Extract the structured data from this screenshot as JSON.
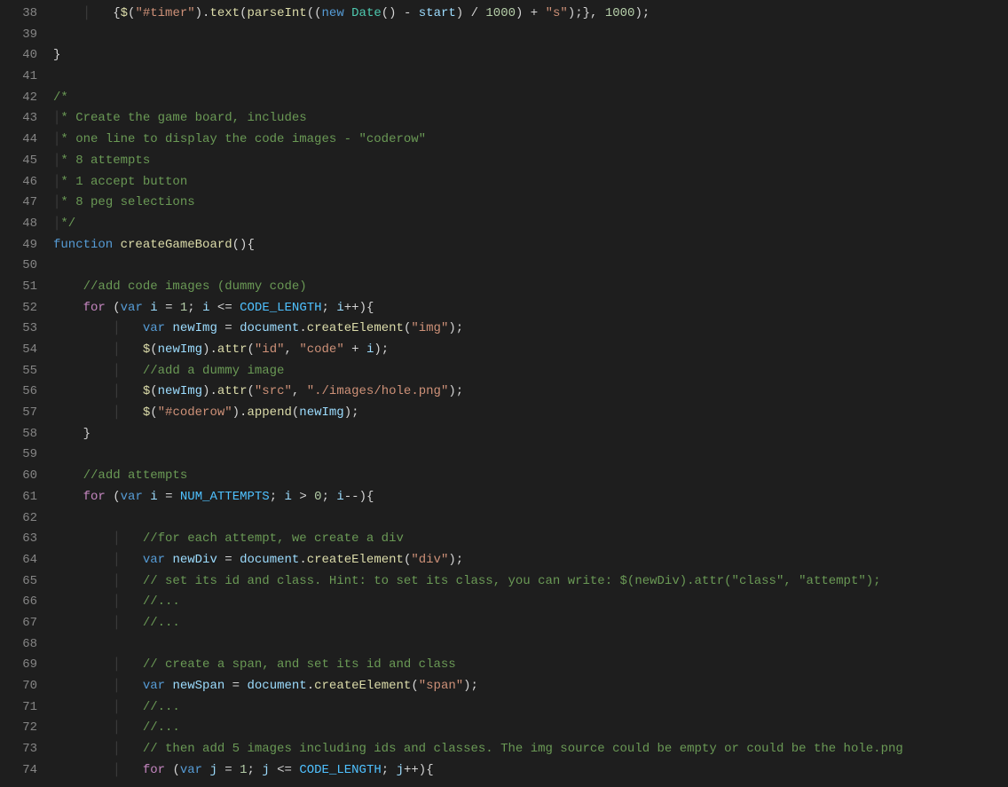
{
  "lines": [
    {
      "num": 38,
      "indent": 1,
      "tokens": [
        {
          "t": "guide",
          "v": "│   "
        },
        {
          "t": "op",
          "v": "{"
        },
        {
          "t": "fn",
          "v": "$"
        },
        {
          "t": "op",
          "v": "("
        },
        {
          "t": "str",
          "v": "\"#timer\""
        },
        {
          "t": "op",
          "v": ")."
        },
        {
          "t": "fn",
          "v": "text"
        },
        {
          "t": "op",
          "v": "("
        },
        {
          "t": "fn",
          "v": "parseInt"
        },
        {
          "t": "op",
          "v": "(("
        },
        {
          "t": "kw",
          "v": "new"
        },
        {
          "t": "op",
          "v": " "
        },
        {
          "t": "cls",
          "v": "Date"
        },
        {
          "t": "op",
          "v": "() - "
        },
        {
          "t": "var",
          "v": "start"
        },
        {
          "t": "op",
          "v": ") / "
        },
        {
          "t": "num",
          "v": "1000"
        },
        {
          "t": "op",
          "v": ") + "
        },
        {
          "t": "str",
          "v": "\"s\""
        },
        {
          "t": "op",
          "v": ");}, "
        },
        {
          "t": "num",
          "v": "1000"
        },
        {
          "t": "op",
          "v": ");"
        }
      ]
    },
    {
      "num": 39,
      "indent": 0,
      "tokens": []
    },
    {
      "num": 40,
      "indent": 0,
      "tokens": [
        {
          "t": "op",
          "v": "}"
        }
      ]
    },
    {
      "num": 41,
      "indent": 0,
      "tokens": []
    },
    {
      "num": 42,
      "indent": 0,
      "tokens": [
        {
          "t": "cm",
          "v": "/*"
        }
      ]
    },
    {
      "num": 43,
      "indent": 0,
      "tokens": [
        {
          "t": "guide",
          "v": "│"
        },
        {
          "t": "cm",
          "v": "* Create the game board, includes"
        }
      ]
    },
    {
      "num": 44,
      "indent": 0,
      "tokens": [
        {
          "t": "guide",
          "v": "│"
        },
        {
          "t": "cm",
          "v": "* one line to display the code images - \"coderow\""
        }
      ]
    },
    {
      "num": 45,
      "indent": 0,
      "tokens": [
        {
          "t": "guide",
          "v": "│"
        },
        {
          "t": "cm",
          "v": "* 8 attempts"
        }
      ]
    },
    {
      "num": 46,
      "indent": 0,
      "tokens": [
        {
          "t": "guide",
          "v": "│"
        },
        {
          "t": "cm",
          "v": "* 1 accept button"
        }
      ]
    },
    {
      "num": 47,
      "indent": 0,
      "tokens": [
        {
          "t": "guide",
          "v": "│"
        },
        {
          "t": "cm",
          "v": "* 8 peg selections"
        }
      ]
    },
    {
      "num": 48,
      "indent": 0,
      "tokens": [
        {
          "t": "guide",
          "v": "│"
        },
        {
          "t": "cm",
          "v": "*/"
        }
      ]
    },
    {
      "num": 49,
      "indent": 0,
      "tokens": [
        {
          "t": "kw",
          "v": "function"
        },
        {
          "t": "op",
          "v": " "
        },
        {
          "t": "fn",
          "v": "createGameBoard"
        },
        {
          "t": "op",
          "v": "(){"
        }
      ]
    },
    {
      "num": 50,
      "indent": 0,
      "tokens": []
    },
    {
      "num": 51,
      "indent": 1,
      "tokens": [
        {
          "t": "cm",
          "v": "//add code images (dummy code)"
        }
      ]
    },
    {
      "num": 52,
      "indent": 1,
      "tokens": [
        {
          "t": "kw2",
          "v": "for"
        },
        {
          "t": "op",
          "v": " ("
        },
        {
          "t": "kw",
          "v": "var"
        },
        {
          "t": "op",
          "v": " "
        },
        {
          "t": "var",
          "v": "i"
        },
        {
          "t": "op",
          "v": " = "
        },
        {
          "t": "num",
          "v": "1"
        },
        {
          "t": "op",
          "v": "; "
        },
        {
          "t": "var",
          "v": "i"
        },
        {
          "t": "op",
          "v": " <= "
        },
        {
          "t": "const",
          "v": "CODE_LENGTH"
        },
        {
          "t": "op",
          "v": "; "
        },
        {
          "t": "var",
          "v": "i"
        },
        {
          "t": "op",
          "v": "++){"
        }
      ]
    },
    {
      "num": 53,
      "indent": 2,
      "tokens": [
        {
          "t": "guide",
          "v": "│   "
        },
        {
          "t": "kw",
          "v": "var"
        },
        {
          "t": "op",
          "v": " "
        },
        {
          "t": "var",
          "v": "newImg"
        },
        {
          "t": "op",
          "v": " = "
        },
        {
          "t": "var",
          "v": "document"
        },
        {
          "t": "op",
          "v": "."
        },
        {
          "t": "fn",
          "v": "createElement"
        },
        {
          "t": "op",
          "v": "("
        },
        {
          "t": "str",
          "v": "\"img\""
        },
        {
          "t": "op",
          "v": ");"
        }
      ]
    },
    {
      "num": 54,
      "indent": 2,
      "tokens": [
        {
          "t": "guide",
          "v": "│   "
        },
        {
          "t": "fn",
          "v": "$"
        },
        {
          "t": "op",
          "v": "("
        },
        {
          "t": "var",
          "v": "newImg"
        },
        {
          "t": "op",
          "v": ")."
        },
        {
          "t": "fn",
          "v": "attr"
        },
        {
          "t": "op",
          "v": "("
        },
        {
          "t": "str",
          "v": "\"id\""
        },
        {
          "t": "op",
          "v": ", "
        },
        {
          "t": "str",
          "v": "\"code\""
        },
        {
          "t": "op",
          "v": " + "
        },
        {
          "t": "var",
          "v": "i"
        },
        {
          "t": "op",
          "v": ");"
        }
      ]
    },
    {
      "num": 55,
      "indent": 2,
      "tokens": [
        {
          "t": "guide",
          "v": "│   "
        },
        {
          "t": "cm",
          "v": "//add a dummy image"
        }
      ]
    },
    {
      "num": 56,
      "indent": 2,
      "tokens": [
        {
          "t": "guide",
          "v": "│   "
        },
        {
          "t": "fn",
          "v": "$"
        },
        {
          "t": "op",
          "v": "("
        },
        {
          "t": "var",
          "v": "newImg"
        },
        {
          "t": "op",
          "v": ")."
        },
        {
          "t": "fn",
          "v": "attr"
        },
        {
          "t": "op",
          "v": "("
        },
        {
          "t": "str",
          "v": "\"src\""
        },
        {
          "t": "op",
          "v": ", "
        },
        {
          "t": "str",
          "v": "\"./images/hole.png\""
        },
        {
          "t": "op",
          "v": ");"
        }
      ]
    },
    {
      "num": 57,
      "indent": 2,
      "tokens": [
        {
          "t": "guide",
          "v": "│   "
        },
        {
          "t": "fn",
          "v": "$"
        },
        {
          "t": "op",
          "v": "("
        },
        {
          "t": "str",
          "v": "\"#coderow\""
        },
        {
          "t": "op",
          "v": ")."
        },
        {
          "t": "fn",
          "v": "append"
        },
        {
          "t": "op",
          "v": "("
        },
        {
          "t": "var",
          "v": "newImg"
        },
        {
          "t": "op",
          "v": ");"
        }
      ]
    },
    {
      "num": 58,
      "indent": 1,
      "tokens": [
        {
          "t": "op",
          "v": "}"
        }
      ]
    },
    {
      "num": 59,
      "indent": 0,
      "tokens": []
    },
    {
      "num": 60,
      "indent": 1,
      "tokens": [
        {
          "t": "cm",
          "v": "//add attempts"
        }
      ]
    },
    {
      "num": 61,
      "indent": 1,
      "tokens": [
        {
          "t": "kw2",
          "v": "for"
        },
        {
          "t": "op",
          "v": " ("
        },
        {
          "t": "kw",
          "v": "var"
        },
        {
          "t": "op",
          "v": " "
        },
        {
          "t": "var",
          "v": "i"
        },
        {
          "t": "op",
          "v": " = "
        },
        {
          "t": "const",
          "v": "NUM_ATTEMPTS"
        },
        {
          "t": "op",
          "v": "; "
        },
        {
          "t": "var",
          "v": "i"
        },
        {
          "t": "op",
          "v": " > "
        },
        {
          "t": "num",
          "v": "0"
        },
        {
          "t": "op",
          "v": "; "
        },
        {
          "t": "var",
          "v": "i"
        },
        {
          "t": "op",
          "v": "--){"
        }
      ]
    },
    {
      "num": 62,
      "indent": 0,
      "tokens": []
    },
    {
      "num": 63,
      "indent": 2,
      "tokens": [
        {
          "t": "guide",
          "v": "│   "
        },
        {
          "t": "cm",
          "v": "//for each attempt, we create a div"
        }
      ]
    },
    {
      "num": 64,
      "indent": 2,
      "tokens": [
        {
          "t": "guide",
          "v": "│   "
        },
        {
          "t": "kw",
          "v": "var"
        },
        {
          "t": "op",
          "v": " "
        },
        {
          "t": "var",
          "v": "newDiv"
        },
        {
          "t": "op",
          "v": " = "
        },
        {
          "t": "var",
          "v": "document"
        },
        {
          "t": "op",
          "v": "."
        },
        {
          "t": "fn",
          "v": "createElement"
        },
        {
          "t": "op",
          "v": "("
        },
        {
          "t": "str",
          "v": "\"div\""
        },
        {
          "t": "op",
          "v": ");"
        }
      ]
    },
    {
      "num": 65,
      "indent": 2,
      "tokens": [
        {
          "t": "guide",
          "v": "│   "
        },
        {
          "t": "cm",
          "v": "// set its id and class. Hint: to set its class, you can write: $(newDiv).attr(\"class\", \"attempt\");"
        }
      ]
    },
    {
      "num": 66,
      "indent": 2,
      "tokens": [
        {
          "t": "guide",
          "v": "│   "
        },
        {
          "t": "cm",
          "v": "//..."
        }
      ]
    },
    {
      "num": 67,
      "indent": 2,
      "tokens": [
        {
          "t": "guide",
          "v": "│   "
        },
        {
          "t": "cm",
          "v": "//..."
        }
      ]
    },
    {
      "num": 68,
      "indent": 0,
      "tokens": []
    },
    {
      "num": 69,
      "indent": 2,
      "tokens": [
        {
          "t": "guide",
          "v": "│   "
        },
        {
          "t": "cm",
          "v": "// create a span, and set its id and class"
        }
      ]
    },
    {
      "num": 70,
      "indent": 2,
      "tokens": [
        {
          "t": "guide",
          "v": "│   "
        },
        {
          "t": "kw",
          "v": "var"
        },
        {
          "t": "op",
          "v": " "
        },
        {
          "t": "var",
          "v": "newSpan"
        },
        {
          "t": "op",
          "v": " = "
        },
        {
          "t": "var",
          "v": "document"
        },
        {
          "t": "op",
          "v": "."
        },
        {
          "t": "fn",
          "v": "createElement"
        },
        {
          "t": "op",
          "v": "("
        },
        {
          "t": "str",
          "v": "\"span\""
        },
        {
          "t": "op",
          "v": ");"
        }
      ]
    },
    {
      "num": 71,
      "indent": 2,
      "tokens": [
        {
          "t": "guide",
          "v": "│   "
        },
        {
          "t": "cm",
          "v": "//..."
        }
      ]
    },
    {
      "num": 72,
      "indent": 2,
      "tokens": [
        {
          "t": "guide",
          "v": "│   "
        },
        {
          "t": "cm",
          "v": "//..."
        }
      ]
    },
    {
      "num": 73,
      "indent": 2,
      "tokens": [
        {
          "t": "guide",
          "v": "│   "
        },
        {
          "t": "cm",
          "v": "// then add 5 images including ids and classes. The img source could be empty or could be the hole.png"
        }
      ]
    },
    {
      "num": 74,
      "indent": 2,
      "tokens": [
        {
          "t": "guide",
          "v": "│   "
        },
        {
          "t": "kw2",
          "v": "for"
        },
        {
          "t": "op",
          "v": " ("
        },
        {
          "t": "kw",
          "v": "var"
        },
        {
          "t": "op",
          "v": " "
        },
        {
          "t": "var",
          "v": "j"
        },
        {
          "t": "op",
          "v": " = "
        },
        {
          "t": "num",
          "v": "1"
        },
        {
          "t": "op",
          "v": "; "
        },
        {
          "t": "var",
          "v": "j"
        },
        {
          "t": "op",
          "v": " <= "
        },
        {
          "t": "const",
          "v": "CODE_LENGTH"
        },
        {
          "t": "op",
          "v": "; "
        },
        {
          "t": "var",
          "v": "j"
        },
        {
          "t": "op",
          "v": "++){"
        }
      ]
    }
  ]
}
